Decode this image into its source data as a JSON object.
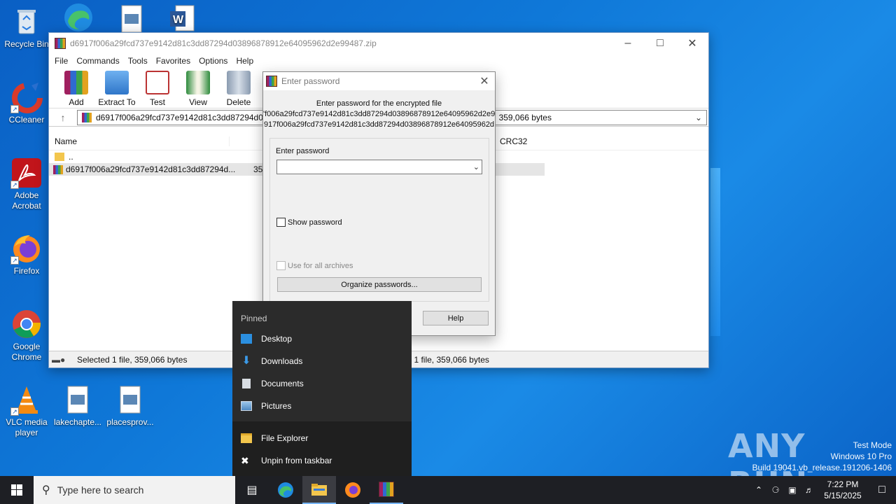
{
  "desktop": {
    "icons": [
      {
        "label": "Recycle Bin"
      },
      {
        "label": "CCleaner"
      },
      {
        "label": "Adobe Acrobat"
      },
      {
        "label": "Firefox"
      },
      {
        "label": "Google Chrome"
      },
      {
        "label": "VLC media player"
      },
      {
        "label": "lakechapte..."
      },
      {
        "label": "placesprov..."
      }
    ]
  },
  "winrar": {
    "title": "d6917f006a29fcd737e9142d81c3dd87294d03896878912e64095962d2e99487.zip",
    "menu": [
      "File",
      "Commands",
      "Tools",
      "Favorites",
      "Options",
      "Help"
    ],
    "toolbar": [
      "Add",
      "Extract To",
      "Test",
      "View",
      "Delete"
    ],
    "address": "d6917f006a29fcd737e9142d81c3dd87294d03",
    "address_tail": "359,066 bytes",
    "columns": {
      "name": "Name",
      "crc": "CRC32"
    },
    "rows": [
      {
        "name": "..",
        "size": ""
      },
      {
        "name": "d6917f006a29fcd737e9142d81c3dd87294d...",
        "size": "35"
      }
    ],
    "status_left": "Selected 1 file, 359,066 bytes",
    "status_right": "1 file, 359,066 bytes"
  },
  "password_dialog": {
    "title": "Enter password",
    "message_line1": "Enter password for the encrypted file",
    "message_line2": "'f006a29fcd737e9142d81c3dd87294d03896878912e64095962d2e9",
    "message_line3": "917f006a29fcd737e9142d81c3dd87294d03896878912e64095962d",
    "password_label": "Enter password",
    "password_value": "",
    "show_password": "Show password",
    "use_all": "Use for all archives",
    "organize": "Organize passwords...",
    "help": "Help"
  },
  "jumplist": {
    "header": "Pinned",
    "pinned": [
      "Desktop",
      "Downloads",
      "Documents",
      "Pictures"
    ],
    "actions": [
      "File Explorer",
      "Unpin from taskbar"
    ]
  },
  "taskbar": {
    "search_placeholder": "Type here to search",
    "time": "7:22 PM",
    "date": "5/15/2025"
  },
  "watermark": {
    "brand": "ANY RUN",
    "line1": "Test Mode",
    "line2": "Windows 10 Pro",
    "line3": "Build 19041.vb_release.191206-1406"
  },
  "colors": {
    "accent": "#0f78d8",
    "taskbar": "#1e1f24",
    "jumplist": "#2b2b2b"
  }
}
